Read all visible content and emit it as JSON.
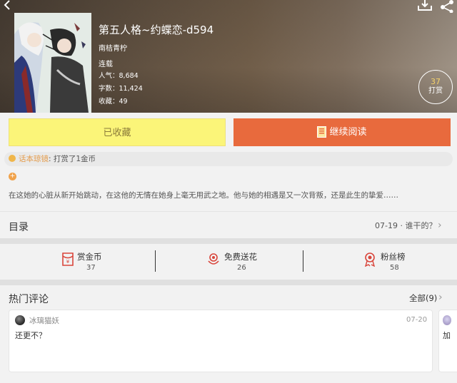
{
  "book": {
    "title": "第五人格~约蝶恋-d594",
    "author": "南桔青柠",
    "status": "连载",
    "popularity": "人气：8,684",
    "word_count": "字数：11,424",
    "favorites": "收藏：49"
  },
  "tip": {
    "count": "37",
    "label": "打赏"
  },
  "actions": {
    "collected_label": "已收藏",
    "continue_label": "继续阅读"
  },
  "notice": {
    "user": "话本琼镜",
    "text": ": 打赏了1金币"
  },
  "summary": "在这她的心脏从新开始跳动，在这他的无情在她身上毫无用武之地。他与她的相遇是又一次背叛，还是此生的挚爱……",
  "toc": {
    "label": "目录",
    "latest": "07-19 · 谁干的？"
  },
  "stats": [
    {
      "label": "赏金币",
      "value": "37",
      "icon": "red-envelope-icon"
    },
    {
      "label": "免费送花",
      "value": "26",
      "icon": "flower-icon"
    },
    {
      "label": "粉丝榜",
      "value": "58",
      "icon": "ribbon-award-icon"
    }
  ],
  "comments_section": {
    "title": "热门评论",
    "all_label": "全部(9)"
  },
  "comments": [
    {
      "user": "冰璃猫妖",
      "date": "07-20",
      "text": "还更不？"
    },
    {
      "text": "加"
    }
  ],
  "colors": {
    "accent_orange": "#e86a3d",
    "collected_yellow": "#fbf579",
    "icon_red": "#d9453b",
    "coin_gold": "#f0b64a"
  }
}
